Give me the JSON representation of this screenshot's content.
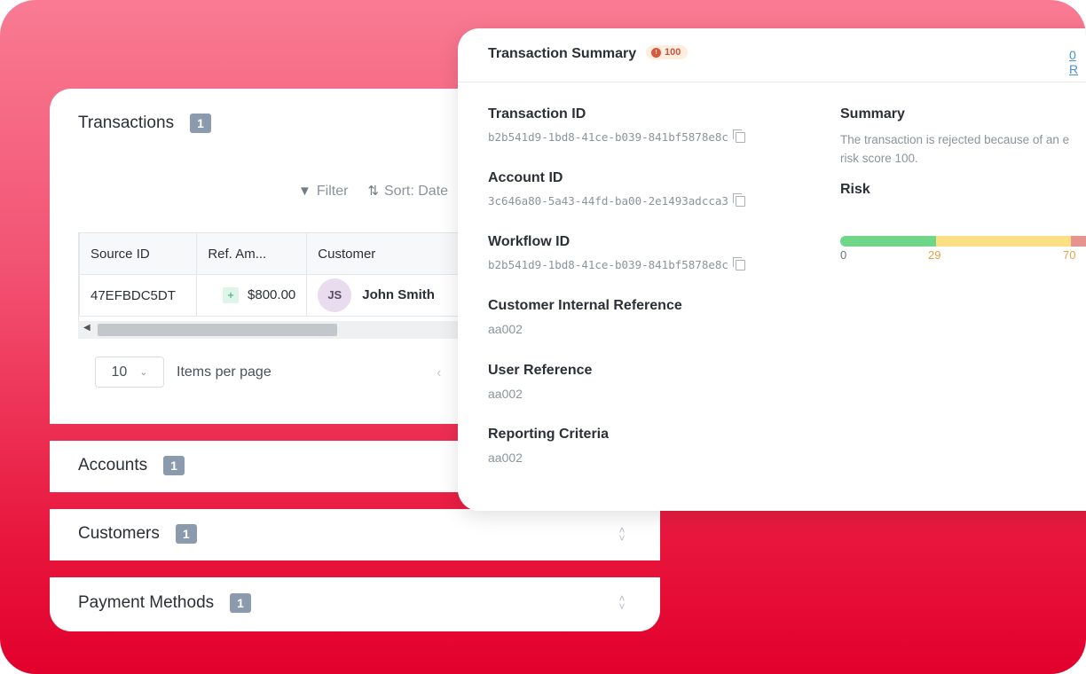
{
  "transactions": {
    "title": "Transactions",
    "count": "1",
    "filter_label": "Filter",
    "sort_label": "Sort: Date",
    "table": {
      "headers": [
        "Source ID",
        "Ref. Am...",
        "Customer"
      ],
      "rows": [
        {
          "source_id": "47EFBDC5DT",
          "amount": "$800.00",
          "initials": "JS",
          "customer": "John Smith"
        }
      ]
    },
    "pager": {
      "page_size": "10",
      "label": "Items per page"
    }
  },
  "accounts": {
    "title": "Accounts",
    "count": "1"
  },
  "customers": {
    "title": "Customers",
    "count": "1"
  },
  "payment_methods": {
    "title": "Payment Methods",
    "count": "1"
  },
  "summary": {
    "title": "Transaction Summary",
    "score": "100",
    "link": "0 R",
    "fields": [
      {
        "label": "Transaction ID",
        "value": "b2b541d9-1bd8-41ce-b039-841bf5878e8c"
      },
      {
        "label": "Account ID",
        "value": "3c646a80-5a43-44fd-ba00-2e1493adcca3"
      },
      {
        "label": "Workflow ID",
        "value": "b2b541d9-1bd8-41ce-b039-841bf5878e8c"
      },
      {
        "label": "Customer Internal Reference",
        "value": "aa002"
      },
      {
        "label": "User Reference",
        "value": "aa002"
      },
      {
        "label": "Reporting Criteria",
        "value": "aa002"
      }
    ],
    "summary_label": "Summary",
    "summary_text_1": "The transaction is rejected because of an e",
    "summary_text_2": "risk score 100.",
    "risk_label": "Risk",
    "risk_scale": {
      "min": "0",
      "low": "29",
      "mid": "70"
    },
    "risk_colors": {
      "low": "#6fd68a",
      "mid": "#fde084",
      "high": "#e8948e"
    }
  }
}
